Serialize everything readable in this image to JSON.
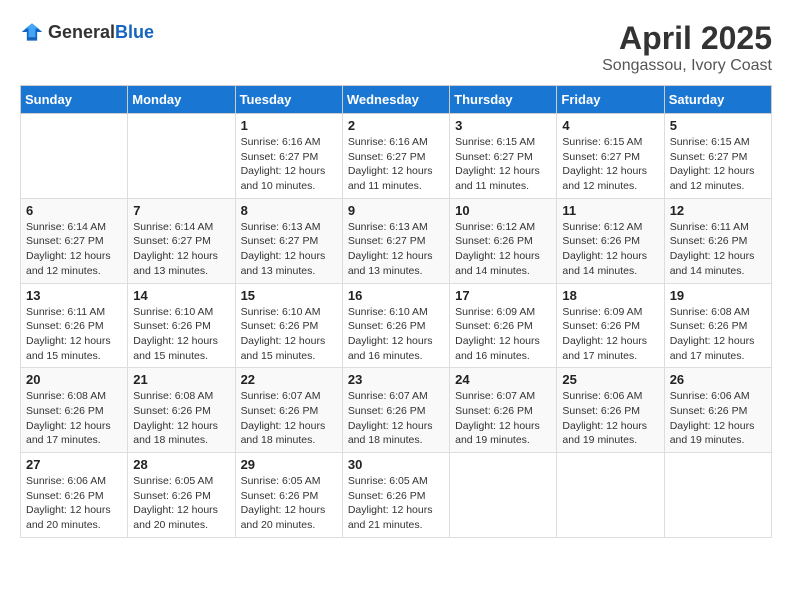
{
  "logo": {
    "general": "General",
    "blue": "Blue"
  },
  "title": "April 2025",
  "subtitle": "Songassou, Ivory Coast",
  "days_header": [
    "Sunday",
    "Monday",
    "Tuesday",
    "Wednesday",
    "Thursday",
    "Friday",
    "Saturday"
  ],
  "weeks": [
    [
      {
        "day": "",
        "info": ""
      },
      {
        "day": "",
        "info": ""
      },
      {
        "day": "1",
        "info": "Sunrise: 6:16 AM\nSunset: 6:27 PM\nDaylight: 12 hours\nand 10 minutes."
      },
      {
        "day": "2",
        "info": "Sunrise: 6:16 AM\nSunset: 6:27 PM\nDaylight: 12 hours\nand 11 minutes."
      },
      {
        "day": "3",
        "info": "Sunrise: 6:15 AM\nSunset: 6:27 PM\nDaylight: 12 hours\nand 11 minutes."
      },
      {
        "day": "4",
        "info": "Sunrise: 6:15 AM\nSunset: 6:27 PM\nDaylight: 12 hours\nand 12 minutes."
      },
      {
        "day": "5",
        "info": "Sunrise: 6:15 AM\nSunset: 6:27 PM\nDaylight: 12 hours\nand 12 minutes."
      }
    ],
    [
      {
        "day": "6",
        "info": "Sunrise: 6:14 AM\nSunset: 6:27 PM\nDaylight: 12 hours\nand 12 minutes."
      },
      {
        "day": "7",
        "info": "Sunrise: 6:14 AM\nSunset: 6:27 PM\nDaylight: 12 hours\nand 13 minutes."
      },
      {
        "day": "8",
        "info": "Sunrise: 6:13 AM\nSunset: 6:27 PM\nDaylight: 12 hours\nand 13 minutes."
      },
      {
        "day": "9",
        "info": "Sunrise: 6:13 AM\nSunset: 6:27 PM\nDaylight: 12 hours\nand 13 minutes."
      },
      {
        "day": "10",
        "info": "Sunrise: 6:12 AM\nSunset: 6:26 PM\nDaylight: 12 hours\nand 14 minutes."
      },
      {
        "day": "11",
        "info": "Sunrise: 6:12 AM\nSunset: 6:26 PM\nDaylight: 12 hours\nand 14 minutes."
      },
      {
        "day": "12",
        "info": "Sunrise: 6:11 AM\nSunset: 6:26 PM\nDaylight: 12 hours\nand 14 minutes."
      }
    ],
    [
      {
        "day": "13",
        "info": "Sunrise: 6:11 AM\nSunset: 6:26 PM\nDaylight: 12 hours\nand 15 minutes."
      },
      {
        "day": "14",
        "info": "Sunrise: 6:10 AM\nSunset: 6:26 PM\nDaylight: 12 hours\nand 15 minutes."
      },
      {
        "day": "15",
        "info": "Sunrise: 6:10 AM\nSunset: 6:26 PM\nDaylight: 12 hours\nand 15 minutes."
      },
      {
        "day": "16",
        "info": "Sunrise: 6:10 AM\nSunset: 6:26 PM\nDaylight: 12 hours\nand 16 minutes."
      },
      {
        "day": "17",
        "info": "Sunrise: 6:09 AM\nSunset: 6:26 PM\nDaylight: 12 hours\nand 16 minutes."
      },
      {
        "day": "18",
        "info": "Sunrise: 6:09 AM\nSunset: 6:26 PM\nDaylight: 12 hours\nand 17 minutes."
      },
      {
        "day": "19",
        "info": "Sunrise: 6:08 AM\nSunset: 6:26 PM\nDaylight: 12 hours\nand 17 minutes."
      }
    ],
    [
      {
        "day": "20",
        "info": "Sunrise: 6:08 AM\nSunset: 6:26 PM\nDaylight: 12 hours\nand 17 minutes."
      },
      {
        "day": "21",
        "info": "Sunrise: 6:08 AM\nSunset: 6:26 PM\nDaylight: 12 hours\nand 18 minutes."
      },
      {
        "day": "22",
        "info": "Sunrise: 6:07 AM\nSunset: 6:26 PM\nDaylight: 12 hours\nand 18 minutes."
      },
      {
        "day": "23",
        "info": "Sunrise: 6:07 AM\nSunset: 6:26 PM\nDaylight: 12 hours\nand 18 minutes."
      },
      {
        "day": "24",
        "info": "Sunrise: 6:07 AM\nSunset: 6:26 PM\nDaylight: 12 hours\nand 19 minutes."
      },
      {
        "day": "25",
        "info": "Sunrise: 6:06 AM\nSunset: 6:26 PM\nDaylight: 12 hours\nand 19 minutes."
      },
      {
        "day": "26",
        "info": "Sunrise: 6:06 AM\nSunset: 6:26 PM\nDaylight: 12 hours\nand 19 minutes."
      }
    ],
    [
      {
        "day": "27",
        "info": "Sunrise: 6:06 AM\nSunset: 6:26 PM\nDaylight: 12 hours\nand 20 minutes."
      },
      {
        "day": "28",
        "info": "Sunrise: 6:05 AM\nSunset: 6:26 PM\nDaylight: 12 hours\nand 20 minutes."
      },
      {
        "day": "29",
        "info": "Sunrise: 6:05 AM\nSunset: 6:26 PM\nDaylight: 12 hours\nand 20 minutes."
      },
      {
        "day": "30",
        "info": "Sunrise: 6:05 AM\nSunset: 6:26 PM\nDaylight: 12 hours\nand 21 minutes."
      },
      {
        "day": "",
        "info": ""
      },
      {
        "day": "",
        "info": ""
      },
      {
        "day": "",
        "info": ""
      }
    ]
  ]
}
